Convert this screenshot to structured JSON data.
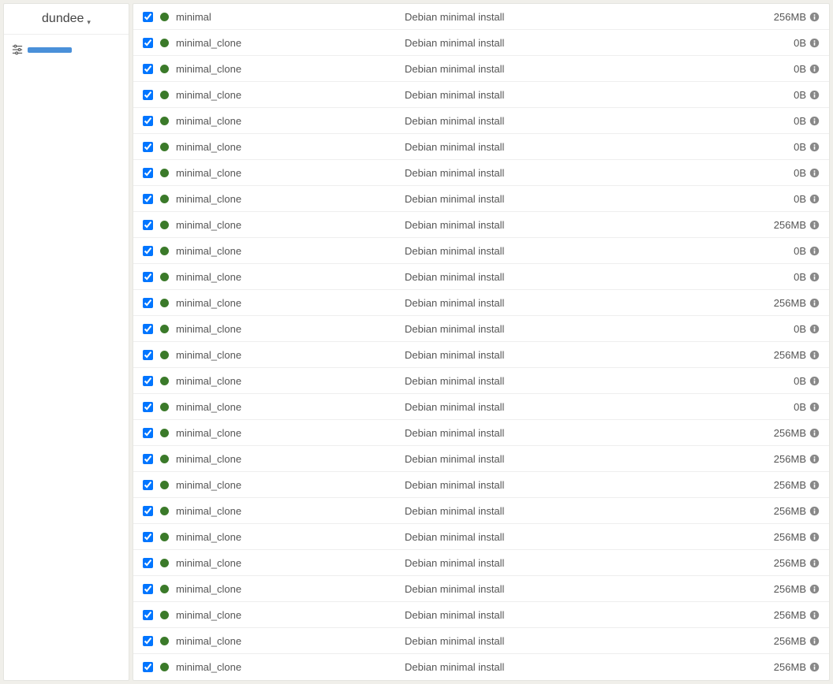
{
  "sidebar": {
    "host": "dundee"
  },
  "status_color": "#3b7a2a",
  "rows": [
    {
      "name": "minimal",
      "desc": "Debian minimal install",
      "size": "256MB",
      "checked": true
    },
    {
      "name": "minimal_clone",
      "desc": "Debian minimal install",
      "size": "0B",
      "checked": true
    },
    {
      "name": "minimal_clone",
      "desc": "Debian minimal install",
      "size": "0B",
      "checked": true
    },
    {
      "name": "minimal_clone",
      "desc": "Debian minimal install",
      "size": "0B",
      "checked": true
    },
    {
      "name": "minimal_clone",
      "desc": "Debian minimal install",
      "size": "0B",
      "checked": true
    },
    {
      "name": "minimal_clone",
      "desc": "Debian minimal install",
      "size": "0B",
      "checked": true
    },
    {
      "name": "minimal_clone",
      "desc": "Debian minimal install",
      "size": "0B",
      "checked": true
    },
    {
      "name": "minimal_clone",
      "desc": "Debian minimal install",
      "size": "0B",
      "checked": true
    },
    {
      "name": "minimal_clone",
      "desc": "Debian minimal install",
      "size": "256MB",
      "checked": true
    },
    {
      "name": "minimal_clone",
      "desc": "Debian minimal install",
      "size": "0B",
      "checked": true
    },
    {
      "name": "minimal_clone",
      "desc": "Debian minimal install",
      "size": "0B",
      "checked": true
    },
    {
      "name": "minimal_clone",
      "desc": "Debian minimal install",
      "size": "256MB",
      "checked": true
    },
    {
      "name": "minimal_clone",
      "desc": "Debian minimal install",
      "size": "0B",
      "checked": true
    },
    {
      "name": "minimal_clone",
      "desc": "Debian minimal install",
      "size": "256MB",
      "checked": true
    },
    {
      "name": "minimal_clone",
      "desc": "Debian minimal install",
      "size": "0B",
      "checked": true
    },
    {
      "name": "minimal_clone",
      "desc": "Debian minimal install",
      "size": "0B",
      "checked": true
    },
    {
      "name": "minimal_clone",
      "desc": "Debian minimal install",
      "size": "256MB",
      "checked": true
    },
    {
      "name": "minimal_clone",
      "desc": "Debian minimal install",
      "size": "256MB",
      "checked": true
    },
    {
      "name": "minimal_clone",
      "desc": "Debian minimal install",
      "size": "256MB",
      "checked": true
    },
    {
      "name": "minimal_clone",
      "desc": "Debian minimal install",
      "size": "256MB",
      "checked": true
    },
    {
      "name": "minimal_clone",
      "desc": "Debian minimal install",
      "size": "256MB",
      "checked": true
    },
    {
      "name": "minimal_clone",
      "desc": "Debian minimal install",
      "size": "256MB",
      "checked": true
    },
    {
      "name": "minimal_clone",
      "desc": "Debian minimal install",
      "size": "256MB",
      "checked": true
    },
    {
      "name": "minimal_clone",
      "desc": "Debian minimal install",
      "size": "256MB",
      "checked": true
    },
    {
      "name": "minimal_clone",
      "desc": "Debian minimal install",
      "size": "256MB",
      "checked": true
    },
    {
      "name": "minimal_clone",
      "desc": "Debian minimal install",
      "size": "256MB",
      "checked": true
    }
  ]
}
